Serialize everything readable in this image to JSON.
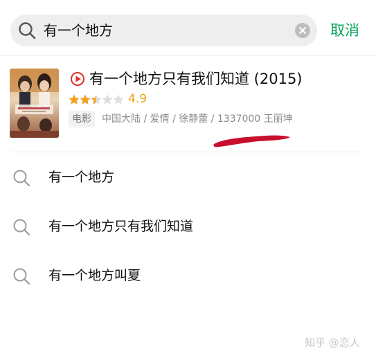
{
  "search": {
    "query": "有一个地方",
    "cancel_label": "取消"
  },
  "result": {
    "title": "有一个地方只有我们知道 (2015)",
    "rating": "4.9",
    "rating_fraction": 0.49,
    "type_tag": "电影",
    "meta": "中国大陆 / 爱情 / 徐静蕾 / 1337000 王丽坤"
  },
  "suggestions": [
    {
      "text": "有一个地方"
    },
    {
      "text": "有一个地方只有我们知道"
    },
    {
      "text": "有一个地方叫夏"
    }
  ],
  "watermark": "知乎 @恋人",
  "colors": {
    "accent": "#07a35a",
    "rating": "#f0a11c",
    "play_icon": "#d9322b",
    "mark": "#c8102e"
  }
}
